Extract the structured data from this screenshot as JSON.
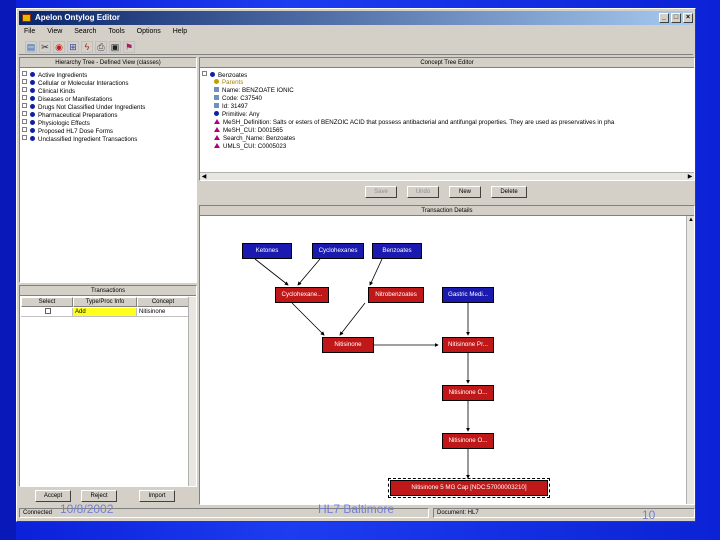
{
  "window": {
    "title": "Apelon Ontylog Editor"
  },
  "menu": [
    "File",
    "View",
    "Search",
    "Tools",
    "Options",
    "Help"
  ],
  "hierarchy": {
    "header": "Hierarchy Tree - Defined View (classes)",
    "items": [
      "Active Ingredients",
      "Cellular or Molecular Interactions",
      "Clinical Kinds",
      "Diseases or Manifestations",
      "Drugs Not Classified Under Ingredients",
      "Pharmaceutical Preparations",
      "Physiologic Effects",
      "Proposed HL7 Dose Forms",
      "Unclassified Ingredient Transactions"
    ]
  },
  "concept_editor": {
    "header": "Concept Tree Editor",
    "root": "Benzoates",
    "items": [
      "Parents",
      "Name: BENZOATE IONIC",
      "Code: C37540",
      "Id: 31497",
      "Primitive: Any",
      "MeSH_Definition: Salts or esters of BENZOIC ACID that possess antibacterial and antifungal properties. They are used as preservatives in pha",
      "MeSH_CUI: D001565",
      "Search_Name: Benzoates",
      "UMLS_CUI: C0005023"
    ],
    "buttons": {
      "save": "Save",
      "undo": "Undo",
      "new": "New",
      "delete": "Delete"
    }
  },
  "transactions": {
    "header": "Transactions",
    "columns": [
      "Select",
      "Type/Proc Info",
      "Concept"
    ],
    "rows": [
      {
        "select": "",
        "type": "Add",
        "concept": "Nitisinone"
      }
    ],
    "buttons": {
      "accept": "Accept",
      "reject": "Reject",
      "import": "Import"
    }
  },
  "transaction_details": {
    "header": "Transaction Details",
    "nodes": {
      "ketones": "Ketones",
      "cyclohexanes": "Cyclohexanes",
      "benzoates": "Benzoates",
      "cyclohexane_dione": "Cyclohexane...",
      "nitrobenzoates": "Nitrobenzoates",
      "gastric_med": "Gastric Medi...",
      "nitisinone": "Nitisinone",
      "nitisinone_pr": "Nitisinone Pr...",
      "nitisinone_o1": "Nitisinone O...",
      "nitisinone_o2": "Nitisinone O...",
      "nitisinone_cap": "Nitisinone 5 MG Cap [NDC:57000003210]"
    }
  },
  "status": {
    "left": "Connected",
    "right": "Document: HL7"
  },
  "slide_footer": {
    "date": "10/8/2002",
    "center": "HL7 Baltimore",
    "page": "10"
  }
}
